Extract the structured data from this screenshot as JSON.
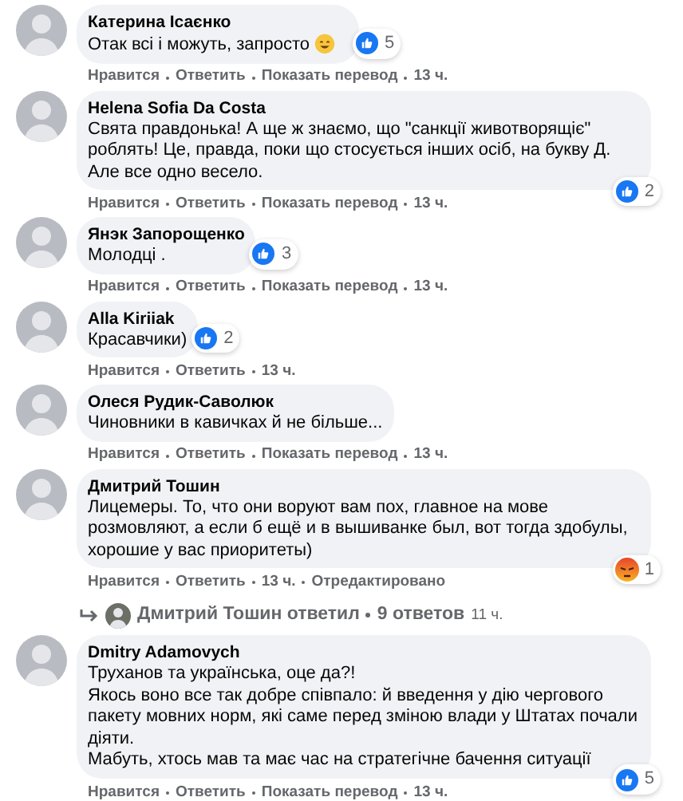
{
  "comments": [
    {
      "author": "Катерина Ісаєнко",
      "text": "Отак всі і можуть, запросто",
      "emoji": true,
      "reaction": {
        "kind": "like",
        "count": "5"
      },
      "actions": [
        "Нравится",
        "Ответить",
        "Показать перевод",
        "13 ч."
      ]
    },
    {
      "author": "Helena Sofia Da Costa",
      "text": "Свята правдонька! А ще ж знаємо, що \"санкції животворящіє\" роблять! Це, правда, поки що стосується інших осіб, на букву Д. Але все одно весело.",
      "reaction": {
        "kind": "like",
        "count": "2"
      },
      "actions": [
        "Нравится",
        "Ответить",
        "Показать перевод",
        "13 ч."
      ]
    },
    {
      "author": "Янэк Запорощенко",
      "text": "Молодці .",
      "reaction": {
        "kind": "like",
        "count": "3"
      },
      "actions": [
        "Нравится",
        "Ответить",
        "Показать перевод",
        "13 ч."
      ]
    },
    {
      "author": "Alla Kiriiak",
      "text": "Красавчики)",
      "reaction": {
        "kind": "like",
        "count": "2"
      },
      "actions": [
        "Нравится",
        "Ответить",
        "13 ч."
      ]
    },
    {
      "author": "Олеся Рудик-Саволюк",
      "text": "Чиновники в кавичках й не більше...",
      "actions": [
        "Нравится",
        "Ответить",
        "Показать перевод",
        "13 ч."
      ]
    },
    {
      "author": "Дмитрий Тошин",
      "text": "Лицемеры. То, что они воруют вам пох, главное на мове розмовляют, а если б ещё и в вышиванке был, вот тогда здобулы, хорошие у вас приоритеты)",
      "reaction": {
        "kind": "angry",
        "count": "1"
      },
      "actions": [
        "Нравится",
        "Ответить",
        "13 ч.",
        "Отредактировано"
      ],
      "replies": {
        "who": "Дмитрий Тошин ответил",
        "count": "9 ответов",
        "time": "11 ч."
      }
    },
    {
      "author": "Dmitry Adamovych",
      "text": "Труханов та українська, оце да?!\nЯкось воно все так добре співпало: й введення у дію чергового пакету мовних норм, які саме перед зміною влади у Штатах почали діяти.\nМабуть, хтось мав та має час на стратегічне бачення ситуації",
      "reaction": {
        "kind": "like",
        "count": "5"
      },
      "actions": [
        "Нравится",
        "Ответить",
        "Показать перевод",
        "13 ч."
      ]
    }
  ]
}
